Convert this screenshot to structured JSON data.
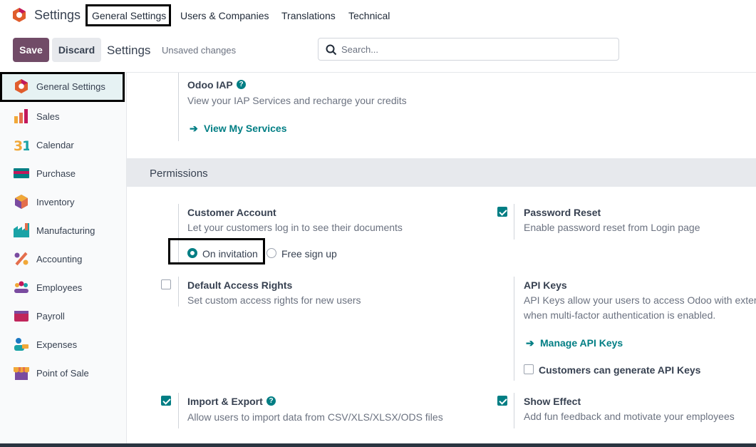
{
  "app": {
    "name": "Settings"
  },
  "nav": {
    "items": [
      "General Settings",
      "Users & Companies",
      "Translations",
      "Technical"
    ]
  },
  "control_panel": {
    "save_label": "Save",
    "discard_label": "Discard",
    "title": "Settings",
    "status": "Unsaved changes",
    "search_placeholder": "Search..."
  },
  "sidebar": {
    "items": [
      {
        "label": "General Settings",
        "icon": "odoo-logo-icon",
        "color": "#e05d2d"
      },
      {
        "label": "Sales",
        "icon": "sales-chart-icon",
        "color": "#e46e4c"
      },
      {
        "label": "Calendar",
        "icon": "calendar-31-icon",
        "color": "#f1a838"
      },
      {
        "label": "Purchase",
        "icon": "purchase-card-icon",
        "color": "#017e84"
      },
      {
        "label": "Inventory",
        "icon": "inventory-box-icon",
        "color": "#7a4ba0"
      },
      {
        "label": "Manufacturing",
        "icon": "manufacturing-factory-icon",
        "color": "#1aa3a6"
      },
      {
        "label": "Accounting",
        "icon": "accounting-percent-icon",
        "color": "#e46e4c"
      },
      {
        "label": "Employees",
        "icon": "employees-people-icon",
        "color": "#7a4ba0"
      },
      {
        "label": "Payroll",
        "icon": "payroll-wallet-icon",
        "color": "#c0265b"
      },
      {
        "label": "Expenses",
        "icon": "expenses-person-icon",
        "color": "#1a78c2"
      },
      {
        "label": "Point of Sale",
        "icon": "pos-shop-icon",
        "color": "#e46e4c"
      }
    ]
  },
  "iap": {
    "title": "Odoo IAP",
    "desc": "View your IAP Services and recharge your credits",
    "link": "View My Services"
  },
  "permissions": {
    "heading": "Permissions",
    "customer_account": {
      "title": "Customer Account",
      "desc": "Let your customers log in to see their documents",
      "options": [
        "On invitation",
        "Free sign up"
      ],
      "selected": "On invitation"
    },
    "password_reset": {
      "title": "Password Reset",
      "desc": "Enable password reset from Login page",
      "checked": true
    },
    "default_access": {
      "title": "Default Access Rights",
      "desc": "Set custom access rights for new users",
      "checked": false
    },
    "api_keys": {
      "title": "API Keys",
      "desc_line1": "API Keys allow your users to access Odoo with extern",
      "desc_line2": "when multi-factor authentication is enabled.",
      "link": "Manage API Keys",
      "option_label": "Customers can generate API Keys",
      "option_checked": false
    },
    "import_export": {
      "title": "Import & Export",
      "desc": "Allow users to import data from CSV/XLS/XLSX/ODS files",
      "checked": true
    },
    "show_effect": {
      "title": "Show Effect",
      "desc": "Add fun feedback and motivate your employees",
      "checked": true
    }
  },
  "colors": {
    "brand": "#714b67",
    "accent": "#017e84"
  }
}
